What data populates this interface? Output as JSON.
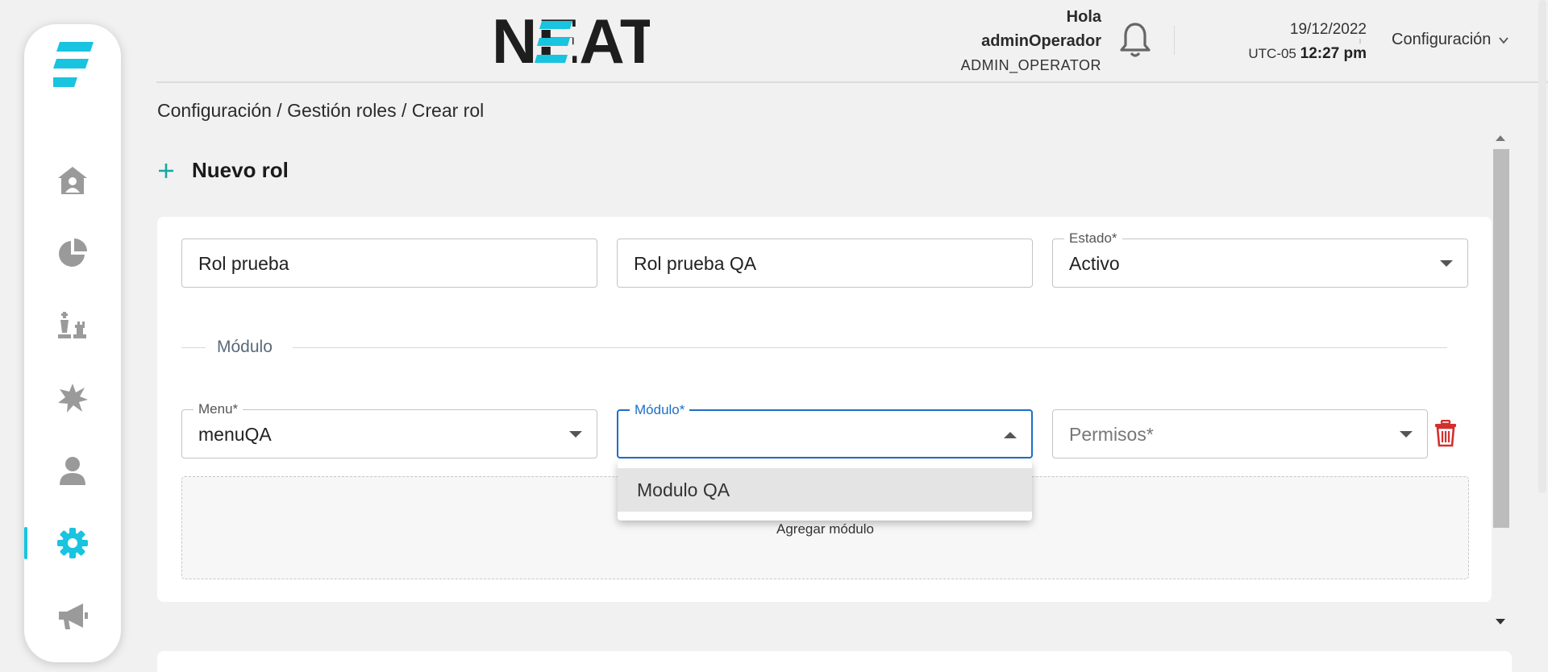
{
  "sidebar": {
    "items": [
      {
        "name": "home",
        "icon": "home-user-icon"
      },
      {
        "name": "reports",
        "icon": "pie-chart-icon"
      },
      {
        "name": "strategy",
        "icon": "chess-pieces-icon"
      },
      {
        "name": "alerts",
        "icon": "burst-icon"
      },
      {
        "name": "users",
        "icon": "user-icon"
      },
      {
        "name": "settings",
        "icon": "gear-icon",
        "active": true
      },
      {
        "name": "campaigns",
        "icon": "megaphone-icon"
      }
    ],
    "accent_color": "#18c4e0",
    "icon_color": "#9a9a9a"
  },
  "header": {
    "brand": "NEAT",
    "greeting": "Hola",
    "username": "adminOperador",
    "role": "ADMIN_OPERATOR",
    "date": "19/12/2022",
    "timezone": "UTC-05",
    "time": "12:27 pm",
    "config_menu": "Configuración"
  },
  "breadcrumb": "Configuración / Gestión roles / Crear rol",
  "page_title": "Nuevo rol",
  "form": {
    "name_value": "Rol prueba",
    "description_value": "Rol prueba QA",
    "estado_label": "Estado*",
    "estado_value": "Activo",
    "section_label": "Módulo",
    "menu_label": "Menu*",
    "menu_value": "menuQA",
    "modulo_label": "Módulo*",
    "modulo_value": "",
    "permisos_placeholder": "Permisos*",
    "add_module_label": "Agregar módulo",
    "dropdown_options": [
      "Modulo QA"
    ]
  },
  "colors": {
    "focus": "#1d6fc8",
    "danger": "#d32f2f",
    "teal": "#1aa6a0"
  }
}
